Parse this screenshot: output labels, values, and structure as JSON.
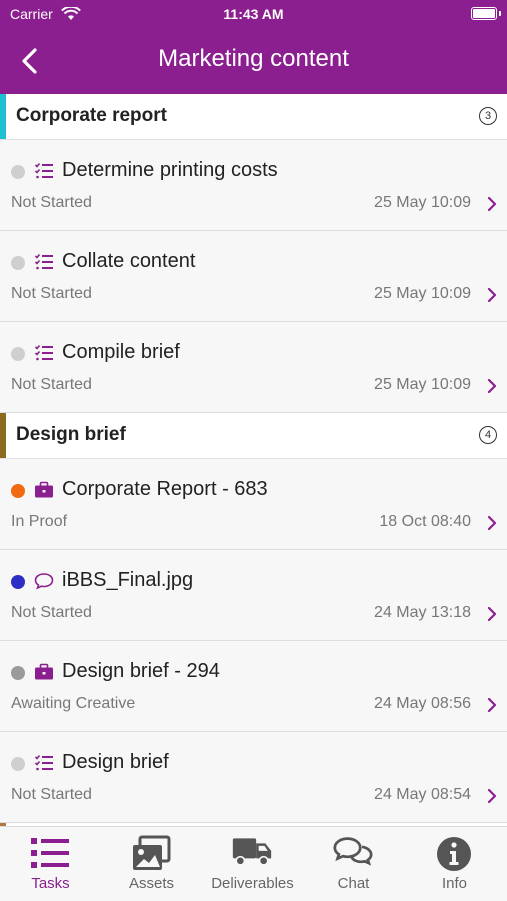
{
  "status_bar": {
    "carrier": "Carrier",
    "time": "11:43 AM"
  },
  "nav": {
    "title": "Marketing content"
  },
  "colors": {
    "brand": "#8b1f8f",
    "grey_dot": "#cfcfcf",
    "dark_grey_dot": "#9a9a9a",
    "orange_dot": "#f06a12",
    "blue_dot": "#2c2ec4"
  },
  "sections": [
    {
      "title": "Corporate report",
      "count": "3",
      "accent": "#1fbfcf",
      "tasks": [
        {
          "name": "Determine printing costs",
          "status": "Not Started",
          "date": "25 May 10:09",
          "icon": "checklist-icon",
          "dot": "#cfcfcf"
        },
        {
          "name": "Collate content",
          "status": "Not Started",
          "date": "25 May 10:09",
          "icon": "checklist-icon",
          "dot": "#cfcfcf"
        },
        {
          "name": "Compile brief",
          "status": "Not Started",
          "date": "25 May 10:09",
          "icon": "checklist-icon",
          "dot": "#cfcfcf"
        }
      ]
    },
    {
      "title": "Design brief",
      "count": "4",
      "accent": "#8a6b1e",
      "tasks": [
        {
          "name": "Corporate Report - 683",
          "status": "In Proof",
          "date": "18 Oct 08:40",
          "icon": "briefcase-icon",
          "dot": "#f06a12"
        },
        {
          "name": "iBBS_Final.jpg",
          "status": "Not Started",
          "date": "24 May 13:18",
          "icon": "comment-icon",
          "dot": "#2c2ec4"
        },
        {
          "name": "Design brief - 294",
          "status": "Awaiting Creative",
          "date": "24 May 08:56",
          "icon": "briefcase-icon",
          "dot": "#9a9a9a"
        },
        {
          "name": "Design brief",
          "status": "Not Started",
          "date": "24 May 08:54",
          "icon": "checklist-icon",
          "dot": "#cfcfcf"
        }
      ]
    }
  ],
  "tabs": [
    {
      "label": "Tasks",
      "icon": "list-icon",
      "active": true
    },
    {
      "label": "Assets",
      "icon": "images-icon",
      "active": false
    },
    {
      "label": "Deliverables",
      "icon": "truck-icon",
      "active": false
    },
    {
      "label": "Chat",
      "icon": "chat-bubbles-icon",
      "active": false
    },
    {
      "label": "Info",
      "icon": "info-icon",
      "active": false
    }
  ]
}
